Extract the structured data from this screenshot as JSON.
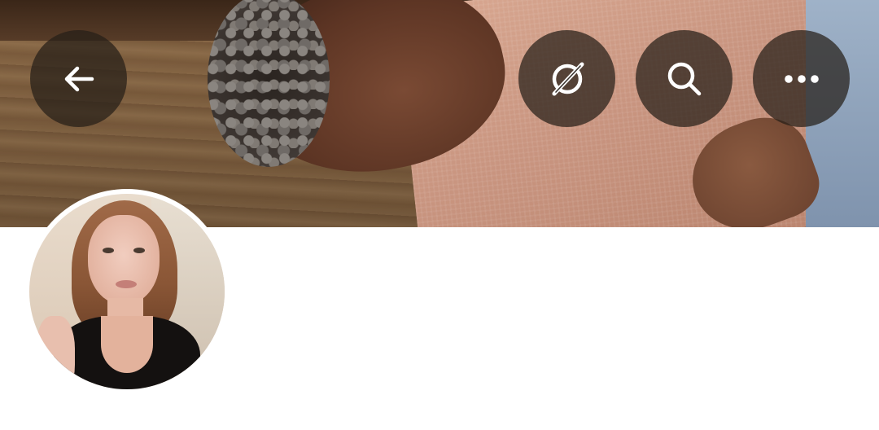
{
  "header": {
    "banner": {
      "description_icon": "banner-photo"
    },
    "buttons": {
      "back": {
        "icon": "arrow-left-icon"
      },
      "grok": {
        "icon": "grok-slash-circle-icon"
      },
      "search": {
        "icon": "search-icon"
      },
      "more": {
        "icon": "more-horizontal-icon"
      }
    },
    "button_background": "#261e18"
  },
  "profile": {
    "avatar": {
      "icon": "profile-avatar"
    }
  },
  "colors": {
    "page_background": "#ffffff",
    "icon_color": "#ffffff"
  }
}
